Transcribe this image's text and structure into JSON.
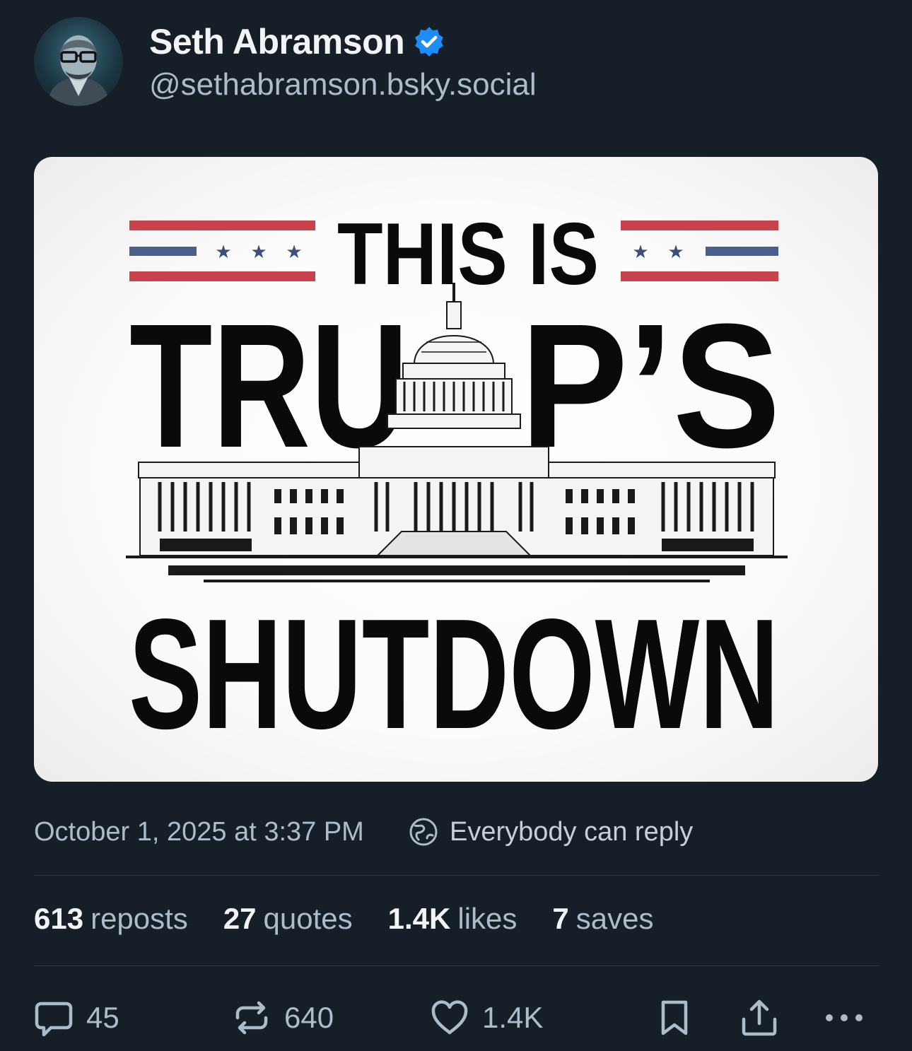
{
  "author": {
    "display_name": "Seth Abramson",
    "handle": "@sethabramson.bsky.social",
    "verified_icon": "verified-check-icon",
    "avatar": "avatar-illustration"
  },
  "image": {
    "line1": "THIS IS",
    "line2_left": "TRU",
    "line2_right": "P’S",
    "line3": "SHUTDOWN",
    "stripe_colors": {
      "red": "#c8414b",
      "blue": "#4a5f8e",
      "star": "#3d4f7c"
    }
  },
  "meta": {
    "timestamp": "October 1, 2025 at 3:37 PM",
    "reply_setting": "Everybody can reply",
    "reply_icon": "globe-icon"
  },
  "stats": {
    "reposts_num": "613",
    "reposts_label": "reposts",
    "quotes_num": "27",
    "quotes_label": "quotes",
    "likes_num": "1.4K",
    "likes_label": "likes",
    "saves_num": "7",
    "saves_label": "saves"
  },
  "actions": {
    "reply_count": "45",
    "repost_count": "640",
    "like_count": "1.4K"
  },
  "colors": {
    "background": "#161e27",
    "verified": "#1d8cf8",
    "secondary_text": "#aebbc9"
  }
}
